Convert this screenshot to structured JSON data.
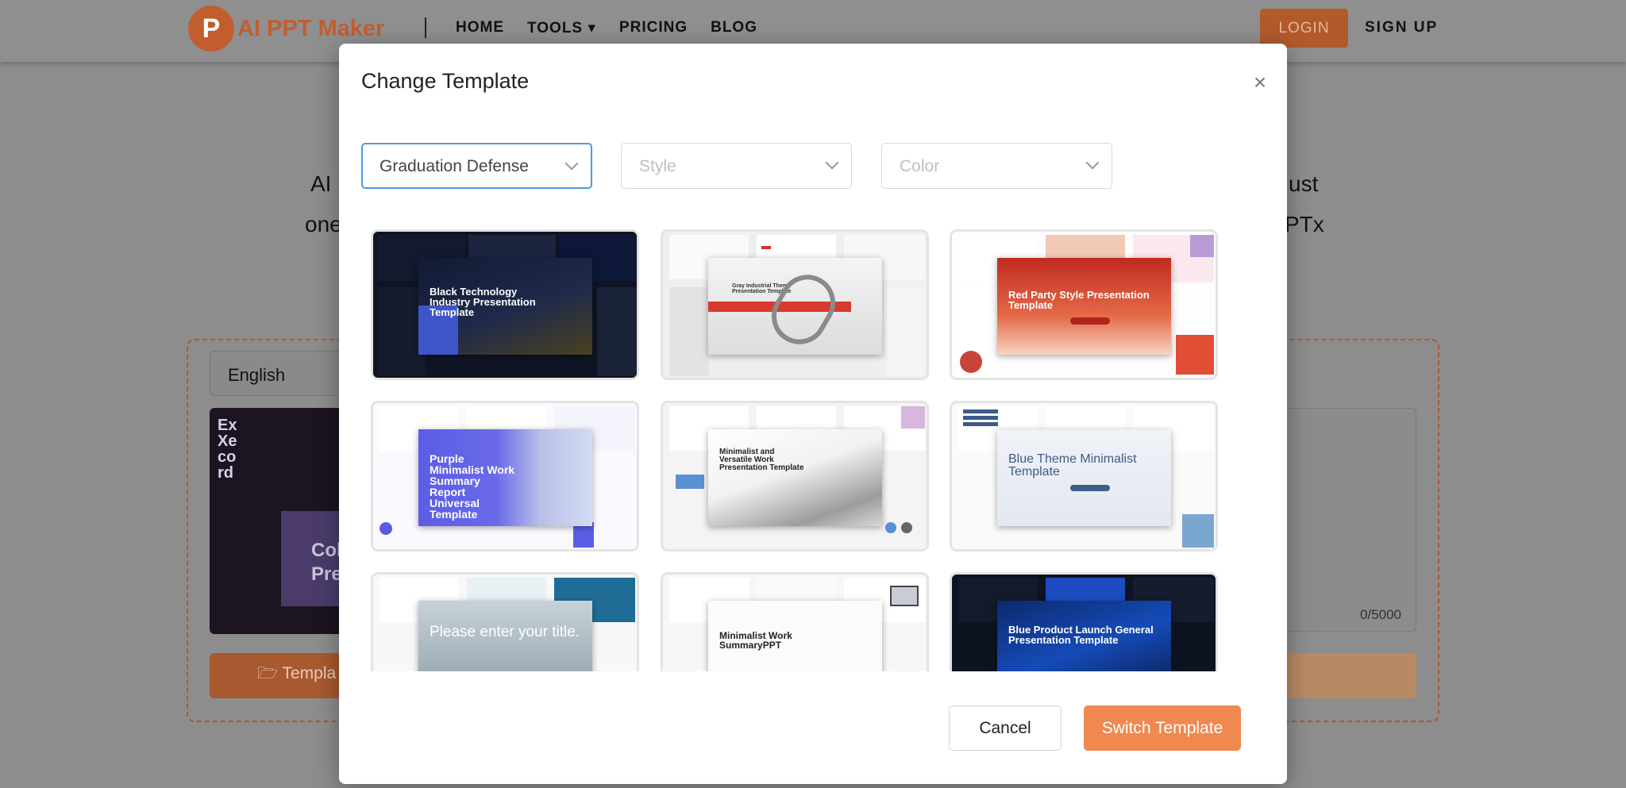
{
  "site": {
    "logo_letter": "P",
    "logo_text": "AI PPT Maker",
    "nav": [
      {
        "label": "HOME"
      },
      {
        "label": "TOOLS ▾"
      },
      {
        "label": "PRICING"
      },
      {
        "label": "BLOG"
      }
    ],
    "login": "LOGIN",
    "signup": "SIGN UP",
    "hero_line1_left": "AI I",
    "hero_line1_right": "ust",
    "hero_line2_left": "one",
    "hero_line2_right": "PTx",
    "language": "English",
    "thumb_text_1": "Ex\nXe\nco\nrd",
    "thumb_text_2": "Col\nPre",
    "counter": "0/5000",
    "template_button": "🗁 Templa"
  },
  "modal": {
    "title": "Change Template",
    "close": "×",
    "filters": [
      {
        "value": "Graduation Defense",
        "placeholder": ""
      },
      {
        "value": "",
        "placeholder": "Style"
      },
      {
        "value": "",
        "placeholder": "Color"
      }
    ],
    "templates": [
      {
        "title": "Black Technology Industry Presentation Template",
        "theme": "dark"
      },
      {
        "title": "Gray Industrial Theme Presentation Template",
        "theme": "gray"
      },
      {
        "title": "Red Party Style Presentation Template",
        "theme": "red"
      },
      {
        "title": "Purple Minimalist Work Summary Report Universal Template",
        "theme": "purple"
      },
      {
        "title": "Minimalist and Versatile Work Presentation Template",
        "theme": "white"
      },
      {
        "title": "Blue Theme Minimalist Template",
        "theme": "lightblue"
      },
      {
        "title": "Please enter your title.",
        "theme": "ink"
      },
      {
        "title": "Minimalist Work SummaryPPT",
        "theme": "minimal"
      },
      {
        "title": "Blue Product Launch General Presentation Template",
        "theme": "navy"
      }
    ],
    "cancel": "Cancel",
    "switch": "Switch Template"
  },
  "colors": {
    "accent": "#f0894f",
    "focus": "#4d9ae0"
  }
}
